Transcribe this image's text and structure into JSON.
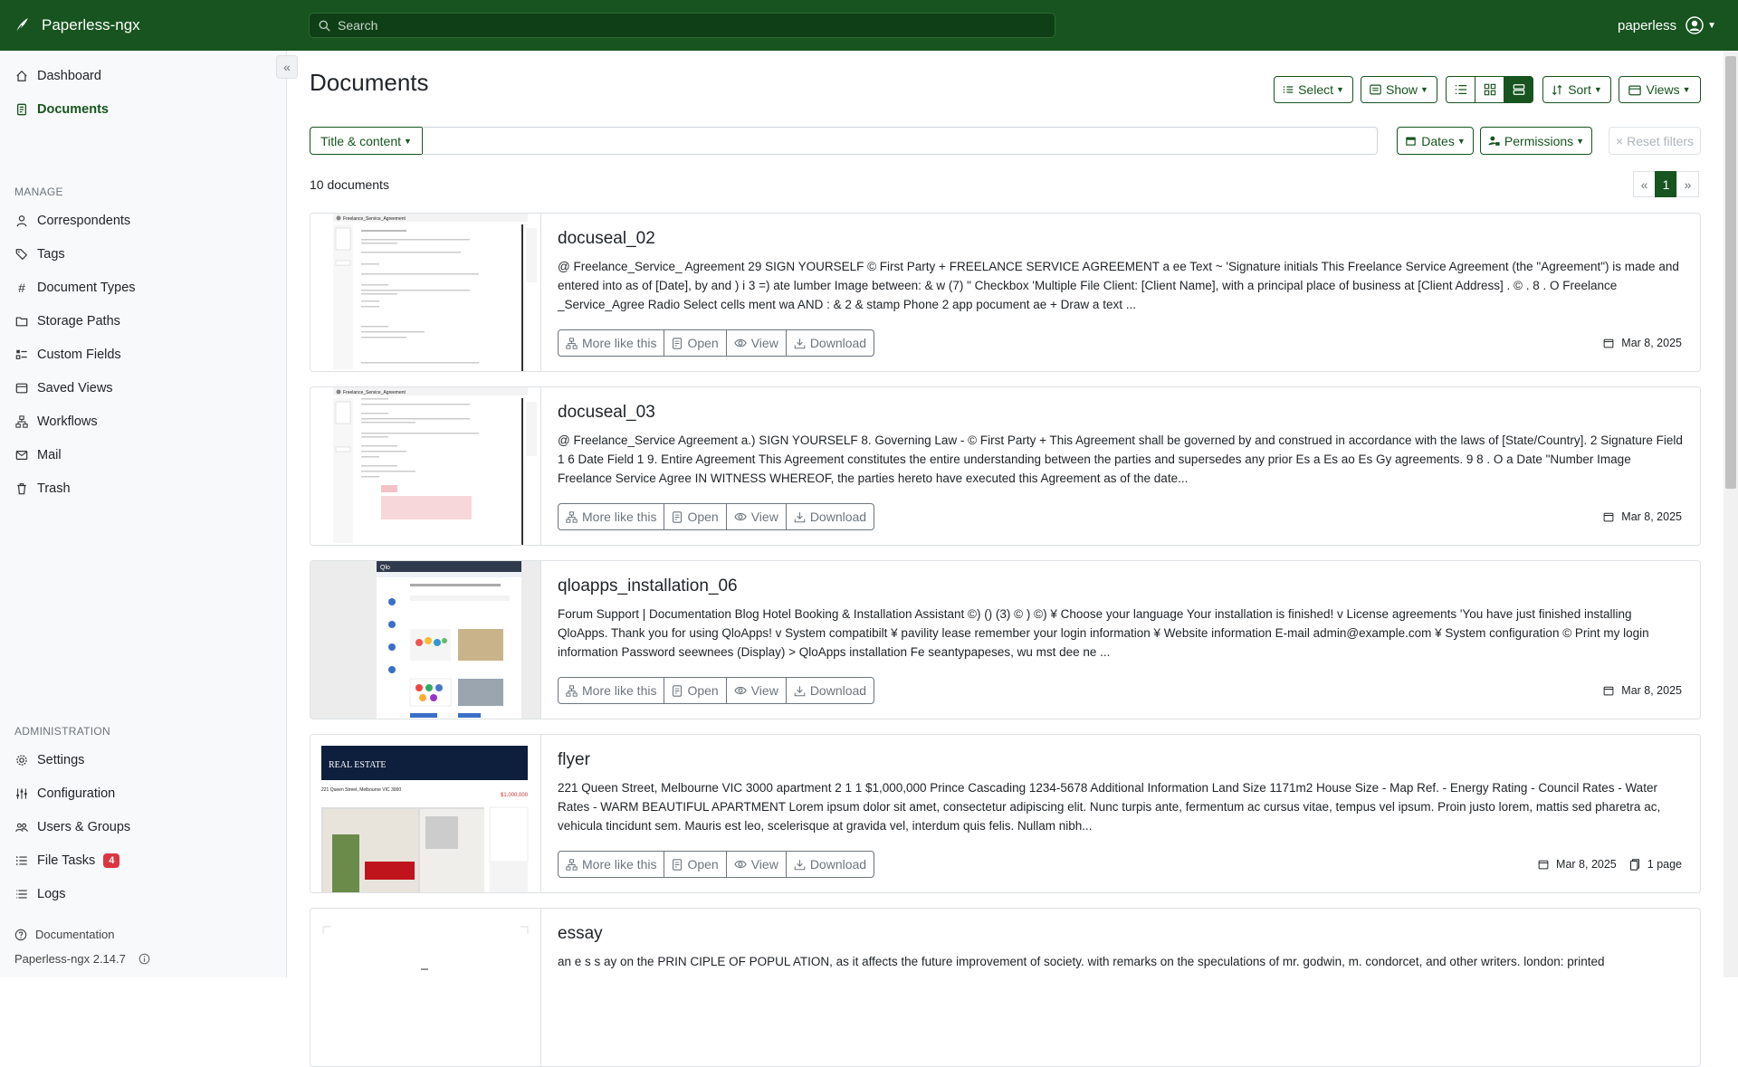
{
  "app": {
    "name": "Paperless-ngx",
    "version": "Paperless-ngx 2.14.7"
  },
  "search": {
    "placeholder": "Search"
  },
  "user": {
    "name": "paperless"
  },
  "sidebar": {
    "top": [
      {
        "label": "Dashboard",
        "icon": "house-icon"
      },
      {
        "label": "Documents",
        "icon": "file-text-icon"
      }
    ],
    "manage_label": "MANAGE",
    "manage": [
      {
        "label": "Correspondents",
        "icon": "person-icon"
      },
      {
        "label": "Tags",
        "icon": "tags-icon"
      },
      {
        "label": "Document Types",
        "icon": "hash-icon"
      },
      {
        "label": "Storage Paths",
        "icon": "folder-icon"
      },
      {
        "label": "Custom Fields",
        "icon": "ui-checks-icon"
      },
      {
        "label": "Saved Views",
        "icon": "window-icon"
      },
      {
        "label": "Workflows",
        "icon": "diagram-icon"
      },
      {
        "label": "Mail",
        "icon": "envelope-icon"
      },
      {
        "label": "Trash",
        "icon": "trash-icon"
      }
    ],
    "admin_label": "ADMINISTRATION",
    "admin": [
      {
        "label": "Settings",
        "icon": "gear-icon"
      },
      {
        "label": "Configuration",
        "icon": "sliders-icon"
      },
      {
        "label": "Users & Groups",
        "icon": "people-icon"
      },
      {
        "label": "File Tasks",
        "icon": "list-task-icon",
        "badge": "4"
      },
      {
        "label": "Logs",
        "icon": "list-icon"
      }
    ],
    "documentation": "Documentation"
  },
  "page": {
    "title": "Documents",
    "toolbar": {
      "select": "Select",
      "show": "Show",
      "sort": "Sort",
      "views": "Views"
    },
    "filter": {
      "field": "Title & content",
      "dates": "Dates",
      "permissions": "Permissions",
      "reset": "Reset filters"
    },
    "count": "10 documents",
    "pager": {
      "prev": "«",
      "current": "1",
      "next": "»"
    }
  },
  "card_actions": {
    "more": "More like this",
    "open": "Open",
    "view": "View",
    "download": "Download"
  },
  "documents": [
    {
      "title": "docuseal_02",
      "content": "@ Freelance_Service_ Agreement 29 SIGN YOURSELF © First Party + FREELANCE SERVICE AGREEMENT a ee Text ~ 'Signature initials This Freelance Service Agreement (the \"Agreement\") is made and entered into as of [Date], by and ) i 3 =) ate lumber Image between: & w (7) \" Checkbox 'Multiple File Client: [Client Name], with a principal place of business at [Client Address] . © . 8 . O Freelance _Service_Agree Radio Select cells ment wa AND : & 2 & stamp Phone 2 app pocument ae + Draw a text ...",
      "date": "Mar 8, 2025"
    },
    {
      "title": "docuseal_03",
      "content": "@ Freelance_Service Agreement a.) SIGN YOURSELF 8. Governing Law - © First Party + This Agreement shall be governed by and construed in accordance with the laws of [State/Country]. 2 Signature Field 1 6 Date Field 1 9. Entire Agreement This Agreement constitutes the entire understanding between the parties and supersedes any prior Es a Es ao Es Gy agreements. 9 8 . O a Date \"Number Image Freelance Service Agree IN WITNESS WHEREOF, the parties hereto have executed this Agreement as of the date...",
      "date": "Mar 8, 2025"
    },
    {
      "title": "qloapps_installation_06",
      "content": "Forum Support | Documentation Blog Hotel Booking & Installation Assistant ©) () (3) © ) ©) ¥ Choose your language Your installation is finished! v License agreements 'You have just finished installing QloApps. Thank you for using QloApps! v System compatibilt ¥ pavility lease remember your login information ¥ Website information E-mail admin@example.com ¥ System configuration © Print my login information Password seewnees (Display) > QloApps installation Fe seantypapeses, wu mst dee ne ...",
      "date": "Mar 8, 2025"
    },
    {
      "title": "flyer",
      "content": "221 Queen Street, Melbourne VIC 3000 apartment 2 1 1 $1,000,000 Prince Cascading 1234-5678 Additional Information Land Size 1171m2 House Size - Map Ref. - Energy Rating - Council Rates - Water Rates - WARM BEAUTIFUL APARTMENT Lorem ipsum dolor sit amet, consectetur adipiscing elit. Nunc turpis ante, fermentum ac cursus vitae, tempus vel ipsum. Proin justo lorem, mattis sed pharetra ac, vehicula tincidunt sem. Mauris est leo, scelerisque at gravida vel, interdum quis felis. Nullam nibh...",
      "date": "Mar 8, 2025",
      "pages": "1 page"
    },
    {
      "title": "essay",
      "content": "an e s s ay on the PRIN CIPLE OF POPUL ATION, as it affects the future improvement of society. with remarks on the speculations of mr. godwin, m. condorcet, and other writers. london: printed"
    }
  ],
  "thumbs": {
    "doc_header": "Freelance_Service_Agreement",
    "flyer_brand": "REAL ESTATE",
    "flyer_address": "221 Queen Street, Melbourne VIC 3000",
    "flyer_price": "$1,000,000"
  },
  "colors": {
    "brand": "#17541f",
    "badge": "#dc3545"
  }
}
